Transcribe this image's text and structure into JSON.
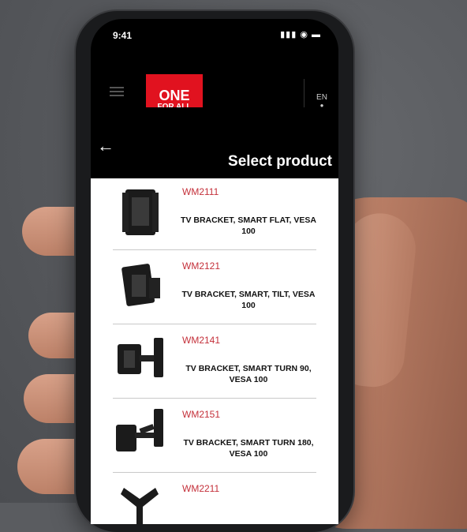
{
  "status": {
    "time": "9:41",
    "icons": "▮▮▮ ◉ ▬"
  },
  "header": {
    "logo_top": "ONE",
    "logo_bottom": "FOR ALL",
    "language": "EN",
    "language_indicator": "●"
  },
  "page": {
    "back_icon": "←",
    "title": "Select product"
  },
  "products": [
    {
      "code": "WM2111",
      "description": "TV BRACKET, SMART FLAT, VESA 100",
      "icon": "flat-bracket-icon"
    },
    {
      "code": "WM2121",
      "description": "TV BRACKET, SMART, TILT, VESA 100",
      "icon": "tilt-bracket-icon"
    },
    {
      "code": "WM2141",
      "description": "TV BRACKET, SMART TURN 90, VESA 100",
      "icon": "turn-bracket-icon"
    },
    {
      "code": "WM2151",
      "description": "TV BRACKET, SMART TURN 180,  VESA 100",
      "icon": "turn180-bracket-icon"
    },
    {
      "code": "WM2211",
      "description": "",
      "icon": "bracket-icon"
    }
  ],
  "colors": {
    "brand_red": "#e1121f",
    "code_red": "#c4303a",
    "header_bg": "#000000",
    "list_bg": "#ffffff"
  }
}
